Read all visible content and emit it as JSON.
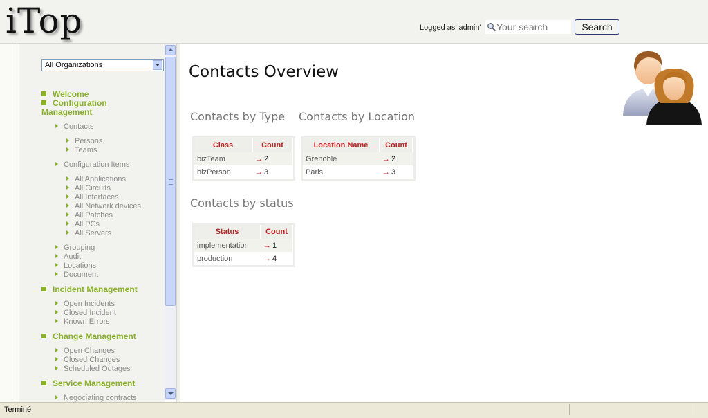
{
  "header": {
    "logo": "iTop",
    "logged_as": "Logged as 'admin'",
    "search_placeholder": "Your search",
    "search_button": "Search"
  },
  "sidebar": {
    "org_select": "All Organizations",
    "sections": {
      "welcome": "Welcome",
      "config": "Configuration Management",
      "incident": "Incident Management",
      "change": "Change Management",
      "service": "Service Management"
    },
    "items": {
      "contacts": "Contacts",
      "persons": "Persons",
      "teams": "Teams",
      "config_items": "Configuration Items",
      "all_applications": "All Applications",
      "all_circuits": "All Circuits",
      "all_interfaces": "All Interfaces",
      "all_network_devices": "All Network devices",
      "all_patches": "All Patches",
      "all_pcs": "All PCs",
      "all_servers": "All Servers",
      "grouping": "Grouping",
      "audit": "Audit",
      "locations": "Locations",
      "document": "Document",
      "open_incidents": "Open Incidents",
      "closed_incident": "Closed Incident",
      "known_errors": "Known Errors",
      "open_changes": "Open Changes",
      "closed_changes": "Closed Changes",
      "scheduled_outages": "Scheduled Outages",
      "negotiating_contracts": "Negociating contracts"
    }
  },
  "main": {
    "title": "Contacts Overview",
    "by_type": {
      "title": "Contacts by Type",
      "col1": "Class",
      "col2": "Count",
      "rows": [
        {
          "name": "bizTeam",
          "count": "2"
        },
        {
          "name": "bizPerson",
          "count": "3"
        }
      ]
    },
    "by_location": {
      "title": "Contacts by Location",
      "col1": "Location Name",
      "col2": "Count",
      "rows": [
        {
          "name": "Grenoble",
          "count": "2"
        },
        {
          "name": "Paris",
          "count": "3"
        }
      ]
    },
    "by_status": {
      "title": "Contacts by status",
      "col1": "Status",
      "col2": "Count",
      "rows": [
        {
          "name": "implementation",
          "count": "1"
        },
        {
          "name": "production",
          "count": "4"
        }
      ]
    },
    "arrow": "→"
  },
  "statusbar": {
    "text": "Terminé"
  },
  "colors": {
    "menu_green": "#8ab02c",
    "header_red": "#bb2222"
  }
}
